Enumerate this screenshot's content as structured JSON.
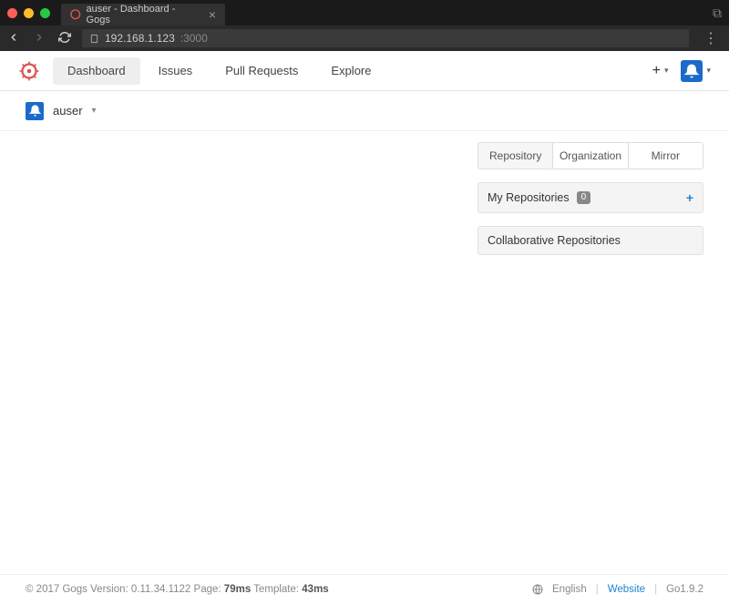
{
  "browser": {
    "tab_title": "auser - Dashboard - Gogs",
    "url_host": "192.168.1.123",
    "url_port": ":3000"
  },
  "nav": {
    "items": [
      {
        "label": "Dashboard",
        "active": true
      },
      {
        "label": "Issues",
        "active": false
      },
      {
        "label": "Pull Requests",
        "active": false
      },
      {
        "label": "Explore",
        "active": false
      }
    ],
    "plus_glyph": "+"
  },
  "context": {
    "username": "auser"
  },
  "sidebar": {
    "tabs": [
      {
        "label": "Repository",
        "active": true
      },
      {
        "label": "Organization",
        "active": false
      },
      {
        "label": "Mirror",
        "active": false
      }
    ],
    "my_repos": {
      "title": "My Repositories",
      "count": "0",
      "add": "+"
    },
    "collab": {
      "title": "Collaborative Repositories"
    }
  },
  "footer": {
    "copyright": "© 2017 Gogs ",
    "version_label": "Version: ",
    "version": "0.11.34.1122",
    "page_label": " Page: ",
    "page_time": "79ms",
    "template_label": " Template: ",
    "template_time": "43ms",
    "language": "English",
    "website": "Website",
    "go_version": "Go1.9.2"
  }
}
